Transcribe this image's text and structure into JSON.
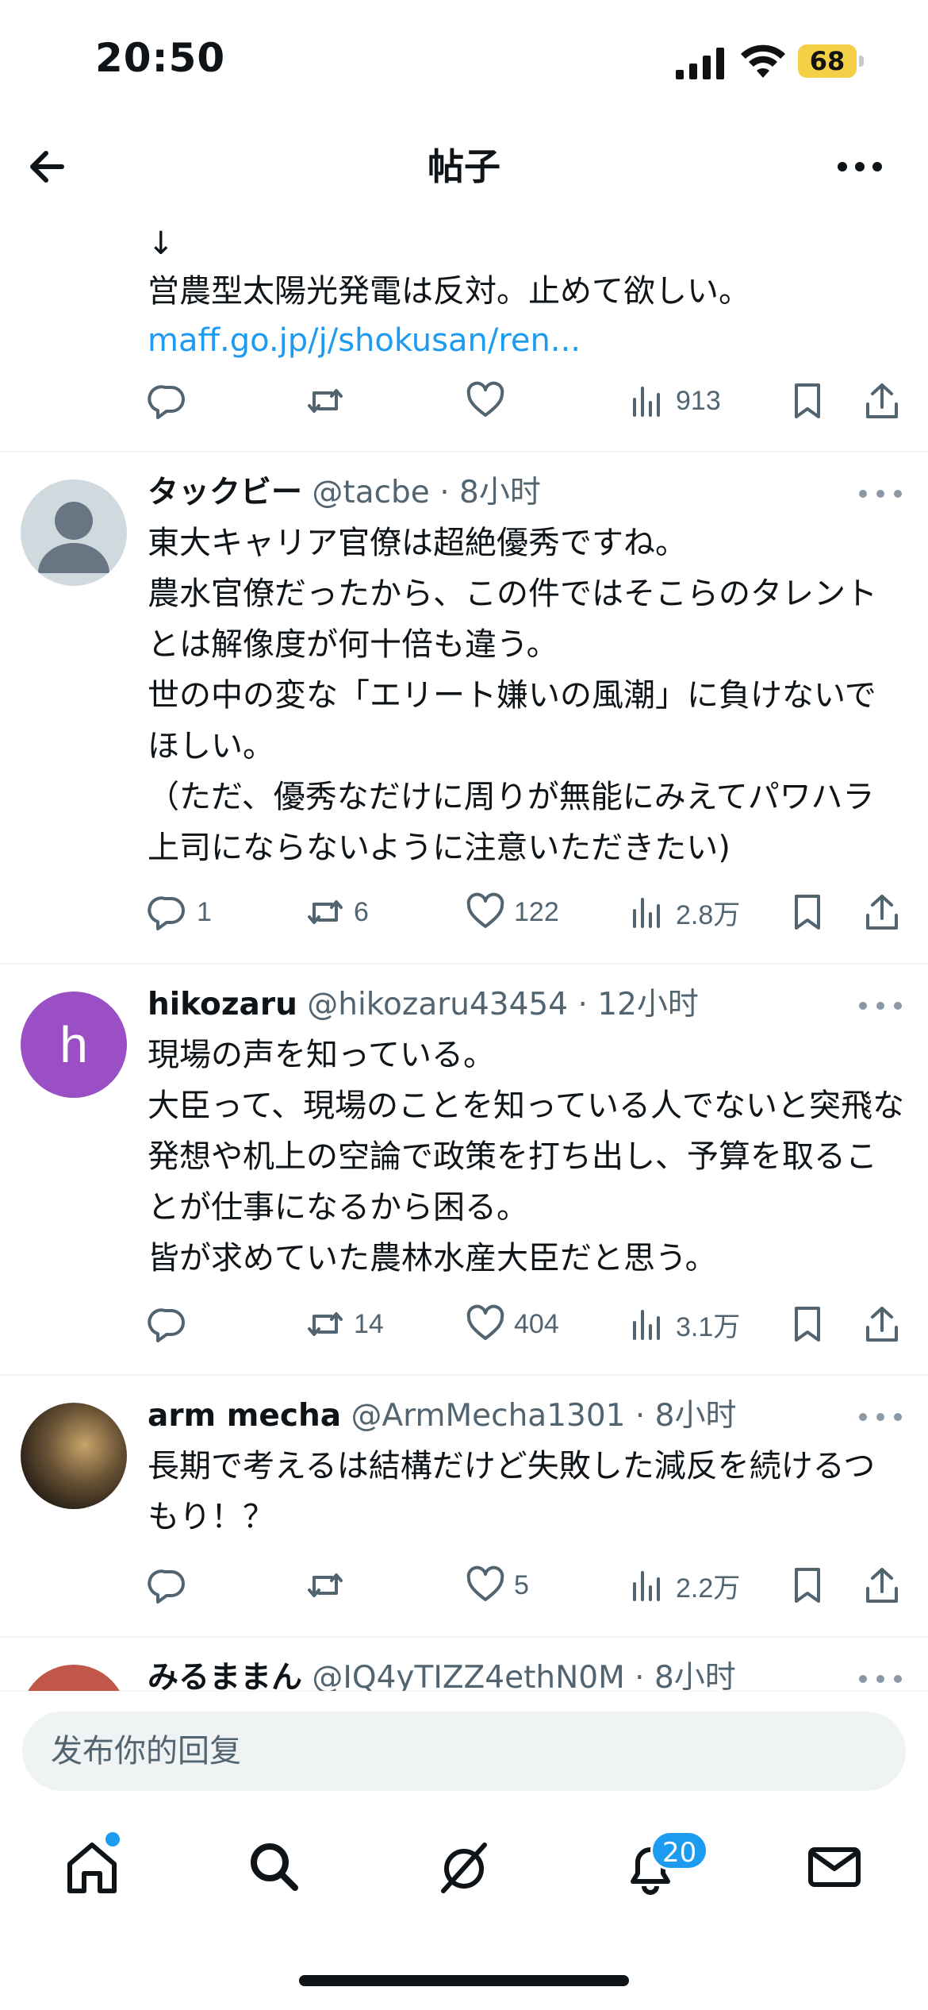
{
  "status_bar": {
    "time": "20:50",
    "battery": "68"
  },
  "header": {
    "title": "帖子"
  },
  "partial_post": {
    "arrow": "↓",
    "text": "営農型太陽光発電は反対。止めて欲しい。",
    "link": "maff.go.jp/j/shokusan/ren...",
    "actions": {
      "reply": "",
      "retweet": "",
      "like": "",
      "views": "913"
    }
  },
  "replies": [
    {
      "name": "タックビー",
      "handle": "@tacbe",
      "dot": "·",
      "time": "8小时",
      "text": "東大キャリア官僚は超絶優秀ですね。\n農水官僚だったから、この件ではそこらのタレントとは解像度が何十倍も違う。\n世の中の変な「エリート嫌いの風潮」に負けないでほしい。\n（ただ、優秀なだけに周りが無能にみえてパワハラ上司にならないように注意いただきたい)",
      "avatar": "default-avatar-icon",
      "actions": {
        "reply": "1",
        "retweet": "6",
        "like": "122",
        "views": "2.8万"
      }
    },
    {
      "name": "hikozaru",
      "handle": "@hikozaru43454",
      "dot": "·",
      "time": "12小时",
      "text": "現場の声を知っている。\n大臣って、現場のことを知っている人でないと突飛な発想や机上の空論で政策を打ち出し、予算を取ることが仕事になるから困る。\n皆が求めていた農林水産大臣だと思う。",
      "avatar_letter": "h",
      "avatar_color": "#9b4fc4",
      "actions": {
        "reply": "",
        "retweet": "14",
        "like": "404",
        "views": "3.1万"
      }
    },
    {
      "name": "arm mecha",
      "handle": "@ArmMecha1301",
      "dot": "·",
      "time": "8小时",
      "text": "長期で考えるは結構だけど失敗した減反を続けるつもり！？",
      "avatar": "photo-avatar",
      "actions": {
        "reply": "",
        "retweet": "",
        "like": "5",
        "views": "2.2万"
      }
    },
    {
      "name": "みるままん",
      "handle": "@IQ4yTIZZ4ethN0M",
      "dot": "·",
      "time": "8小时",
      "avatar_color": "#c0574a"
    }
  ],
  "reply_input": {
    "placeholder": "发布你的回复"
  },
  "tab_bar": {
    "items": [
      "home-icon",
      "search-icon",
      "grok-icon",
      "notifications-icon",
      "messages-icon"
    ],
    "notification_count": "20"
  },
  "colors": {
    "accent": "#1d9bf0",
    "muted": "#536471",
    "divider": "#eff3f4"
  }
}
